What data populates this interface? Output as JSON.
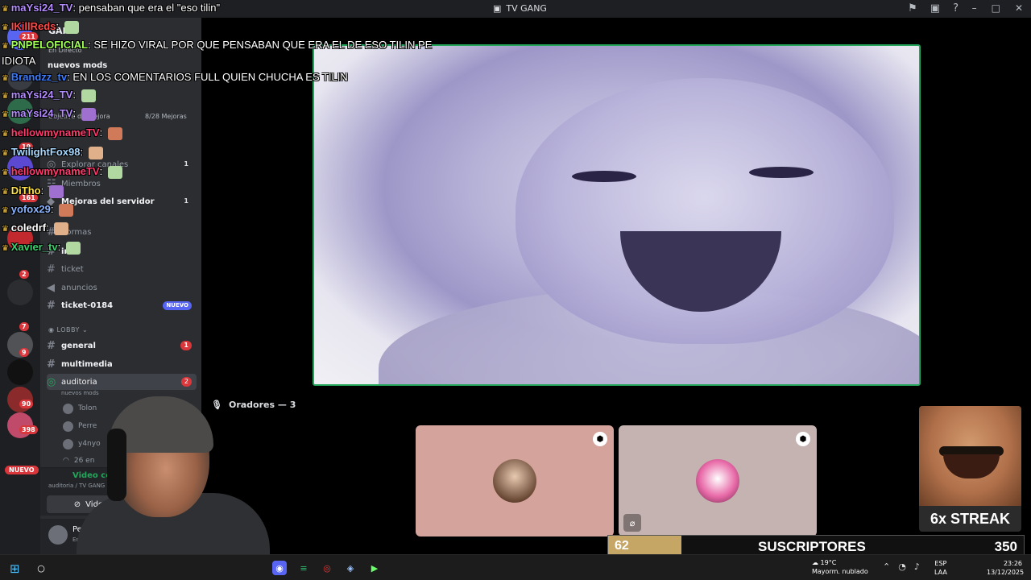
{
  "window": {
    "title": "TV GANG"
  },
  "sidebar": {
    "server_name": "GANG",
    "live": "En Directo",
    "top_channel": "nuevos mods",
    "boost_goal": "Objetivo de mejora",
    "boost_count": "8/28 Mejoras",
    "channels": [
      {
        "label": "Explorar canales",
        "badge": ""
      },
      {
        "label": "Miembros",
        "badge": ""
      },
      {
        "label": "Mejoras del servidor",
        "badge": "1"
      },
      {
        "label": "normas",
        "badge": ""
      },
      {
        "label": "info",
        "badge": ""
      },
      {
        "label": "ticket",
        "badge": ""
      },
      {
        "label": "anuncios",
        "badge": ""
      },
      {
        "label": "ticket-0184",
        "badge": "NUEVO"
      }
    ],
    "category": "LOBBY",
    "lobby_channels": [
      {
        "label": "general",
        "badge": "1"
      },
      {
        "label": "multimedia",
        "badge": ""
      },
      {
        "label": "auditoria",
        "badge": "2"
      }
    ],
    "voice_sub": "nuevos mods",
    "voice_users": [
      "Tolon",
      "Perre",
      "y4nyo",
      "26 en"
    ],
    "voice_connected": "Video conectado",
    "voice_location": "auditoria / TV GANG",
    "video_button": "Video",
    "user_name": "Perre",
    "user_status": "En un esc"
  },
  "rail": {
    "badges": [
      "211",
      "19",
      "161",
      "2",
      "7",
      "9",
      "90",
      "398"
    ],
    "nuevo": "NUEVO"
  },
  "stage": {
    "speakers_label": "Oradores — 3",
    "streak": "6x STREAK",
    "subs": {
      "current": "62",
      "label": "SUSCRIPTORES",
      "goal": "350",
      "progress": 0.177
    }
  },
  "chat": [
    {
      "user": "maYsi24_TV",
      "color": "#b48cff",
      "text": "pensaban que era el \"eso tilin\""
    },
    {
      "user": "IKillReds",
      "color": "#ff4a4a",
      "text": ""
    },
    {
      "user": "PNPELOFICIAL",
      "color": "#9cff52",
      "text": "SE HIZO VIRAL POR QUE PENSABAN QUE ERA EL DE ESO TILIN PE"
    },
    {
      "user": "",
      "color": "#ffffff",
      "text": "IDIOTA"
    },
    {
      "user": "Brandzz_tv",
      "color": "#3b7bff",
      "text": "EN LOS COMENTARIOS FULL QUIEN CHUCHA ES TILIN"
    },
    {
      "user": "maYsi24_TV",
      "color": "#b48cff",
      "text": ""
    },
    {
      "user": "maYsi24_TV",
      "color": "#b48cff",
      "text": ""
    },
    {
      "user": "hellowmynameTV",
      "color": "#ff3b6e",
      "text": ""
    },
    {
      "user": "TwilightFox98",
      "color": "#a8d8ff",
      "text": ""
    },
    {
      "user": "hellowmynameTV",
      "color": "#ff3b6e",
      "text": ""
    },
    {
      "user": "DiTho",
      "color": "#ffe14a",
      "text": ""
    },
    {
      "user": "yofox29",
      "color": "#8ab4ff",
      "text": ""
    },
    {
      "user": "coledrf",
      "color": "#ffffff",
      "text": ""
    },
    {
      "user": "Xavier_tv",
      "color": "#3bd16f",
      "text": ""
    }
  ],
  "taskbar": {
    "weather_temp": "19°C",
    "weather_desc": "Mayorm. nublado",
    "lang_top": "ESP",
    "lang_bottom": "LAA",
    "time": "23:26",
    "date": "13/12/2025",
    "rail_ghost": "26"
  }
}
